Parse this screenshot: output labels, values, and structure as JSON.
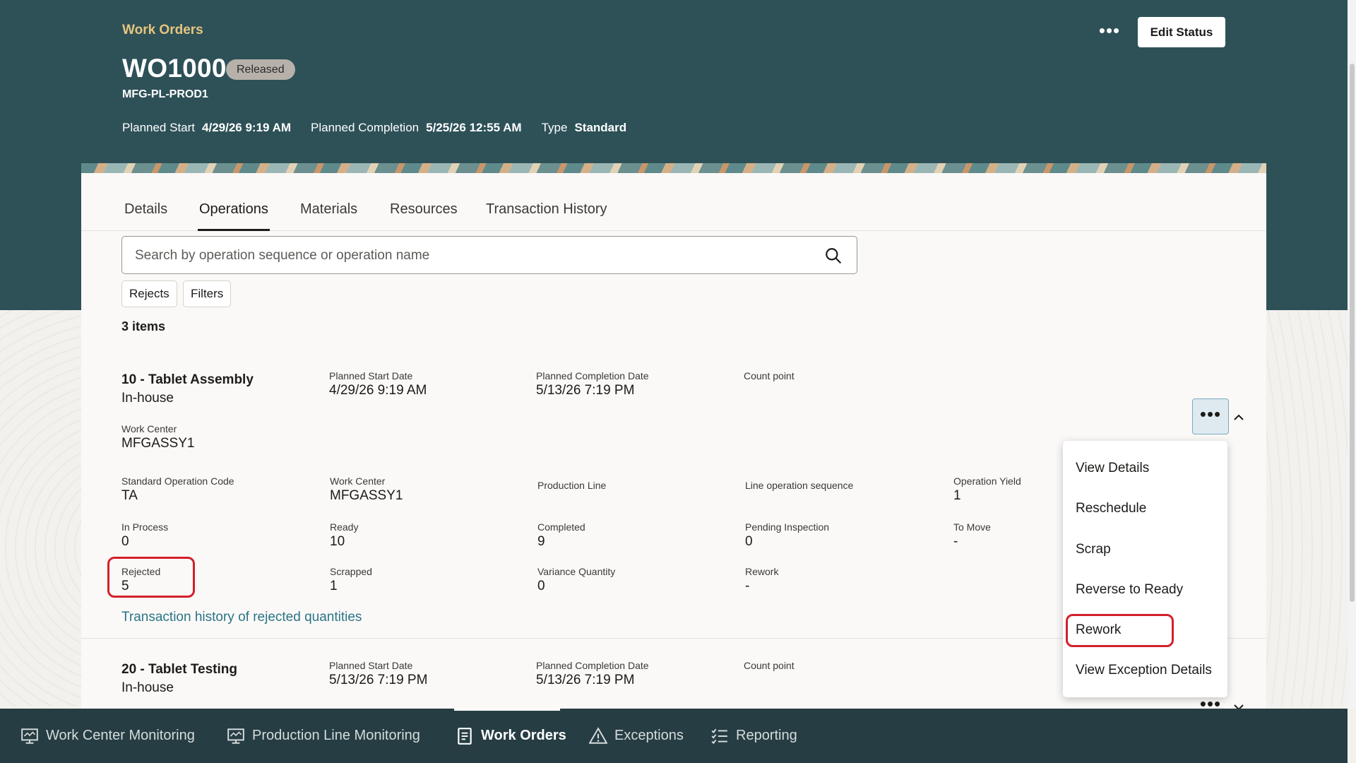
{
  "header": {
    "breadcrumb": "Work Orders",
    "title": "WO1000",
    "status": "Released",
    "subtitle": "MFG-PL-PROD1",
    "more_label": "•••",
    "edit_status_label": "Edit Status",
    "meta": [
      {
        "label": "Planned Start",
        "value": "4/29/26 9:19 AM"
      },
      {
        "label": "Planned Completion",
        "value": "5/25/26 12:55 AM"
      },
      {
        "label": "Type",
        "value": "Standard"
      }
    ]
  },
  "tabs": [
    {
      "label": "Details"
    },
    {
      "label": "Operations",
      "active": true
    },
    {
      "label": "Materials"
    },
    {
      "label": "Resources"
    },
    {
      "label": "Transaction History"
    }
  ],
  "search": {
    "placeholder": "Search by operation sequence or operation name",
    "value": ""
  },
  "chips": [
    "Rejects",
    "Filters"
  ],
  "items_count": "3 items",
  "operations": [
    {
      "title": "10 - Tablet Assembly",
      "subtitle": "In-house",
      "planned_start_label": "Planned Start Date",
      "planned_start": "4/29/26 9:19 AM",
      "planned_completion_label": "Planned Completion Date",
      "planned_completion": "5/13/26 7:19 PM",
      "count_point_label": "Count point",
      "work_center_label": "Work Center",
      "work_center": "MFGASSY1",
      "details": [
        {
          "label": "Standard Operation Code",
          "value": "TA"
        },
        {
          "label": "Work Center",
          "value": "MFGASSY1"
        },
        {
          "label": "Production Line",
          "value": ""
        },
        {
          "label": "Line operation sequence",
          "value": ""
        },
        {
          "label": "Operation Yield",
          "value": "1"
        },
        {
          "label": "In Process",
          "value": "0"
        },
        {
          "label": "Ready",
          "value": "10"
        },
        {
          "label": "Completed",
          "value": "9"
        },
        {
          "label": "Pending Inspection",
          "value": "0"
        },
        {
          "label": "To Move",
          "value": "-"
        },
        {
          "label": "Rejected",
          "value": "5"
        },
        {
          "label": "Scrapped",
          "value": "1"
        },
        {
          "label": "Variance Quantity",
          "value": "0"
        },
        {
          "label": "Rework",
          "value": "-"
        }
      ],
      "link": "Transaction history of rejected quantities"
    },
    {
      "title": "20 - Tablet Testing",
      "subtitle": "In-house",
      "planned_start_label": "Planned Start Date",
      "planned_start": "5/13/26 7:19 PM",
      "planned_completion_label": "Planned Completion Date",
      "planned_completion": "5/13/26 7:19 PM",
      "count_point_label": "Count point"
    }
  ],
  "menu": [
    "View Details",
    "Reschedule",
    "Scrap",
    "Reverse to Ready",
    "Rework",
    "View Exception Details"
  ],
  "bottom_nav": [
    {
      "label": "Work Center Monitoring",
      "icon": "monitor-icon"
    },
    {
      "label": "Production Line Monitoring",
      "icon": "monitor-icon"
    },
    {
      "label": "Work Orders",
      "icon": "document-icon",
      "active": true
    },
    {
      "label": "Exceptions",
      "icon": "warning-icon"
    },
    {
      "label": "Reporting",
      "icon": "checklist-icon"
    }
  ],
  "colors": {
    "header_bg": "#2e5158",
    "accent_gold": "#e6c57d",
    "link": "#2a7486",
    "highlight_red": "#d3202a",
    "nav_bg": "#263d43"
  }
}
